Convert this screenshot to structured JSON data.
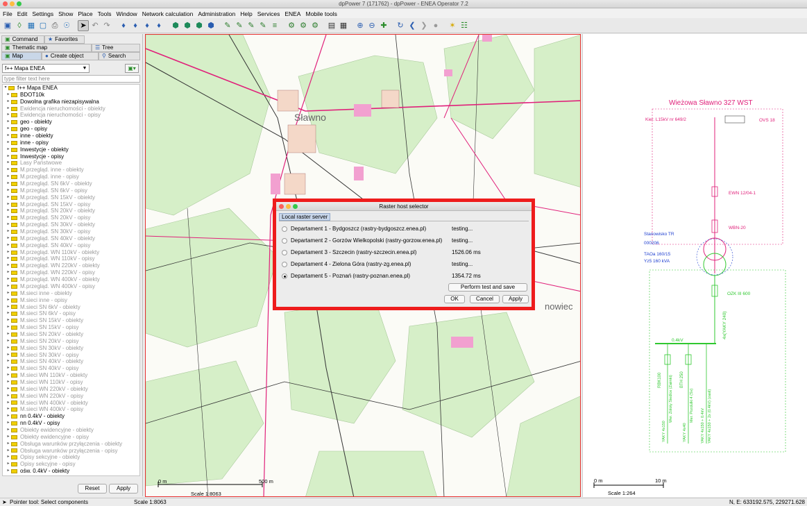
{
  "window": {
    "title": "dpPower 7 (171762) - dpPower - ENEA Operator 7.2"
  },
  "menu": [
    "File",
    "Edit",
    "Settings",
    "Show",
    "Place",
    "Tools",
    "Window",
    "Network calculation",
    "Administration",
    "Help",
    "Services",
    "ENEA",
    "Mobile tools"
  ],
  "left_panel": {
    "tabs_row1": [
      "Command",
      "Favorites"
    ],
    "tabs_row2": [
      "Thematic map",
      "Tree"
    ],
    "tabs_row3": [
      "Map",
      "Create object",
      "Search"
    ],
    "map_selector": "f++ Mapa ENEA",
    "filter_placeholder": "type filter text here",
    "tree_root": "f++ Mapa ENEA",
    "tree_items": [
      {
        "label": "BDOT10k",
        "enabled": true
      },
      {
        "label": "Dowolna grafika niezapisywalna",
        "enabled": true
      },
      {
        "label": "Ewidencja nieruchomości - obiekty",
        "enabled": false
      },
      {
        "label": "Ewidencja nieruchomości - opisy",
        "enabled": false
      },
      {
        "label": "geo - obiekty",
        "enabled": true
      },
      {
        "label": "geo - opisy",
        "enabled": true
      },
      {
        "label": "inne - obiekty",
        "enabled": true
      },
      {
        "label": "inne - opisy",
        "enabled": true
      },
      {
        "label": "Inwestycje - obiekty",
        "enabled": true
      },
      {
        "label": "Inwestycje - opisy",
        "enabled": true
      },
      {
        "label": "Lasy Państwowe",
        "enabled": false
      },
      {
        "label": "M.przegląd. inne - obiekty",
        "enabled": false
      },
      {
        "label": "M.przegląd. inne - opisy",
        "enabled": false
      },
      {
        "label": "M.przegląd. SN 6kV - obiekty",
        "enabled": false
      },
      {
        "label": "M.przegląd. SN 6kV - opisy",
        "enabled": false
      },
      {
        "label": "M.przegląd. SN 15kV - obiekty",
        "enabled": false
      },
      {
        "label": "M.przegląd. SN 15kV - opisy",
        "enabled": false
      },
      {
        "label": "M.przegląd. SN 20kV - obiekty",
        "enabled": false
      },
      {
        "label": "M.przegląd. SN 20kV - opisy",
        "enabled": false
      },
      {
        "label": "M.przegląd. SN 30kV - obiekty",
        "enabled": false
      },
      {
        "label": "M.przegląd. SN 30kV - opisy",
        "enabled": false
      },
      {
        "label": "M.przegląd. SN 40kV - obiekty",
        "enabled": false
      },
      {
        "label": "M.przegląd. SN 40kV - opisy",
        "enabled": false
      },
      {
        "label": "M.przegląd. WN 110kV - obiekty",
        "enabled": false
      },
      {
        "label": "M.przegląd. WN 110kV - opisy",
        "enabled": false
      },
      {
        "label": "M.przegląd. WN 220kV - obiekty",
        "enabled": false
      },
      {
        "label": "M.przegląd. WN 220kV - opisy",
        "enabled": false
      },
      {
        "label": "M.przegląd. WN 400kV - obiekty",
        "enabled": false
      },
      {
        "label": "M.przegląd. WN 400kV - opisy",
        "enabled": false
      },
      {
        "label": "M.sieci inne - obiekty",
        "enabled": false
      },
      {
        "label": "M.sieci inne - opisy",
        "enabled": false
      },
      {
        "label": "M.sieci SN 6kV - obiekty",
        "enabled": false
      },
      {
        "label": "M.sieci SN 6kV - opisy",
        "enabled": false
      },
      {
        "label": "M.sieci SN 15kV - obiekty",
        "enabled": false
      },
      {
        "label": "M.sieci SN 15kV - opisy",
        "enabled": false
      },
      {
        "label": "M.sieci SN 20kV - obiekty",
        "enabled": false
      },
      {
        "label": "M.sieci SN 20kV - opisy",
        "enabled": false
      },
      {
        "label": "M.sieci SN 30kV - obiekty",
        "enabled": false
      },
      {
        "label": "M.sieci SN 30kV - opisy",
        "enabled": false
      },
      {
        "label": "M.sieci SN 40kV - obiekty",
        "enabled": false
      },
      {
        "label": "M.sieci SN 40kV - opisy",
        "enabled": false
      },
      {
        "label": "M.sieci WN 110kV - obiekty",
        "enabled": false
      },
      {
        "label": "M.sieci WN 110kV - opisy",
        "enabled": false
      },
      {
        "label": "M.sieci WN 220kV - obiekty",
        "enabled": false
      },
      {
        "label": "M.sieci WN 220kV - opisy",
        "enabled": false
      },
      {
        "label": "M.sieci WN 400kV - obiekty",
        "enabled": false
      },
      {
        "label": "M.sieci WN 400kV - opisy",
        "enabled": false
      },
      {
        "label": "nn 0.4kV - obiekty",
        "enabled": true
      },
      {
        "label": "nn 0.4kV - opisy",
        "enabled": true
      },
      {
        "label": "Obiekty ewidencyjne - obiekty",
        "enabled": false
      },
      {
        "label": "Obiekty ewidencyjne - opisy",
        "enabled": false
      },
      {
        "label": "Obsługa warunków przyłączenia - obiekty",
        "enabled": false
      },
      {
        "label": "Obsługa warunków przyłączenia - opisy",
        "enabled": false
      },
      {
        "label": "Opisy sekcyjne - obiekty",
        "enabled": false
      },
      {
        "label": "Opisy sekcyjne - opisy",
        "enabled": false
      },
      {
        "label": "ośw. 0.4kV - obiekty",
        "enabled": true
      }
    ],
    "reset_label": "Reset",
    "apply_label": "Apply"
  },
  "map": {
    "town_label": "Sławno",
    "town2_label": "nowiec",
    "scale_start": "0 m",
    "scale_end": "500 m",
    "scale_text": "Scale 1:8063"
  },
  "schematic": {
    "title": "Wieżowa Sławno 327 WST",
    "line_label": "Kier. L15kV nr 649/2",
    "surge": "OVS 18",
    "switch1": "EWN 12/04-1",
    "fuse": "WBN-20",
    "station_type": "Stanowisko TR",
    "station_id": "000206",
    "transformer": "TAOa 160/15",
    "transformer_group": "Yz5 160 kVA",
    "switch2": "OZK III 600",
    "busbar": "0.4kV",
    "cable": "4x(YAKY 240)",
    "feeder1": "RBK100",
    "feeder2": "BTH 250",
    "feeder3_label": "YAKY 4x150",
    "feeder3_sub": "Wer. Zoloty Siedlce (Zaimki)",
    "feeder4_label": "YAKY 4x40",
    "feeder4_sub": "Mer. Pozdulki 4 (Sv)",
    "feeder5_label": "YAKY 4x150 + 0.4kV",
    "feeder5_sub": "YAKY 4x150 + 2x (0.4kV) (zasil)",
    "scale_start": "0 m",
    "scale_end": "10 m",
    "scale_text": "Scale 1:264"
  },
  "status": {
    "tool": "Pointer tool: Select components",
    "scale": "Scale 1:8063",
    "coords": "N, E: 633192.575, 229271.628"
  },
  "dialog": {
    "title": "Raster host selector",
    "tab": "Local raster server",
    "departments": [
      {
        "label": "Departament 1 - Bydgoszcz (rastry-bydgoszcz.enea.pl)",
        "status": "testing...",
        "selected": false
      },
      {
        "label": "Departament 2 - Gorzów Wielkopolski (rastry-gorzow.enea.pl)",
        "status": "testing...",
        "selected": false
      },
      {
        "label": "Departament 3 - Szczecin (rastry-szczecin.enea.pl)",
        "status": "1526.06 ms",
        "selected": false
      },
      {
        "label": "Departament 4 - Zielona Góra (rastry-zg.enea.pl)",
        "status": "testing...",
        "selected": false
      },
      {
        "label": "Departament 5 - Poznań (rastry-poznan.enea.pl)",
        "status": "1354.72 ms",
        "selected": true
      }
    ],
    "perform_label": "Perform test and save",
    "ok_label": "OK",
    "cancel_label": "Cancel",
    "apply_label": "Apply"
  },
  "colors": {
    "accent_red": "#ee1c1c",
    "power_line": "#e0207a",
    "map_green": "#d6efc8",
    "schematic_green": "#2fc82f",
    "schematic_blue": "#2040d0"
  }
}
